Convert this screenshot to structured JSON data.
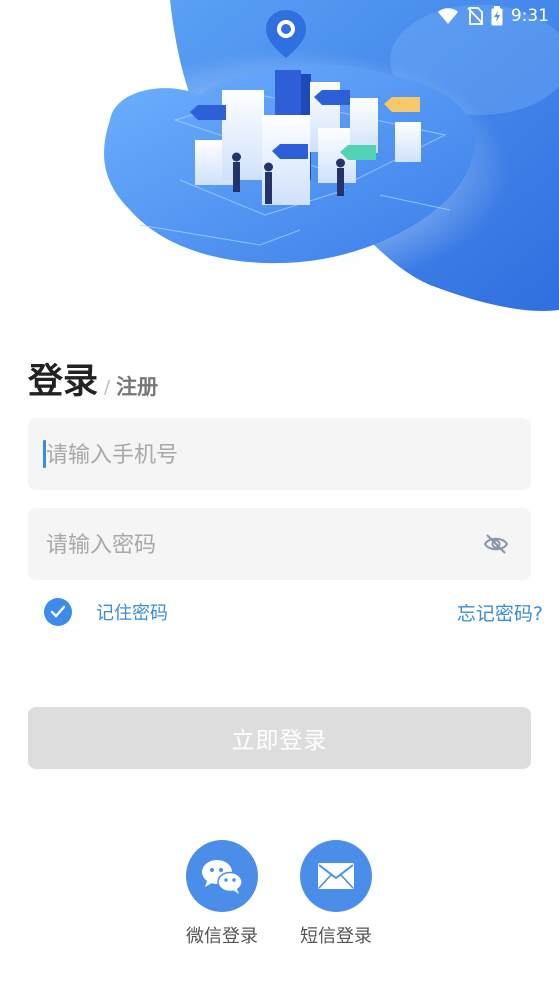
{
  "status_bar": {
    "time": "9:31"
  },
  "header": {
    "login_title": "登录",
    "separator": "/",
    "register_tab": "注册"
  },
  "form": {
    "phone_placeholder": "请输入手机号",
    "password_placeholder": "请输入密码",
    "remember_label": "记住密码",
    "remember_checked": true,
    "forgot_label": "忘记密码?",
    "submit_label": "立即登录"
  },
  "social": [
    {
      "label": "微信登录",
      "icon": "wechat-icon"
    },
    {
      "label": "短信登录",
      "icon": "envelope-icon"
    }
  ],
  "colors": {
    "accent": "#3d8bea",
    "link": "#3a8ed6",
    "disabled_button": "#dddddd",
    "field_bg": "#f5f5f5"
  }
}
